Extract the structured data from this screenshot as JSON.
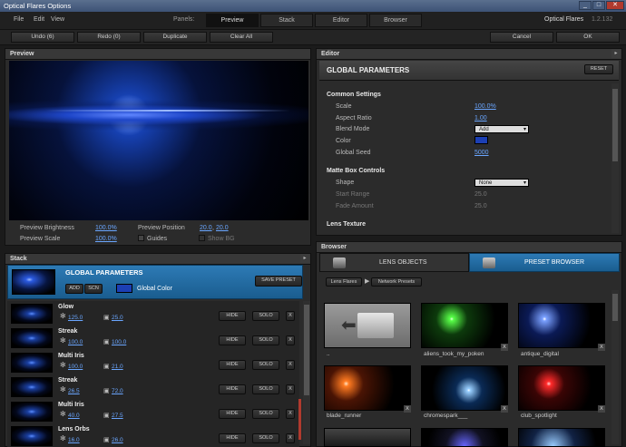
{
  "window": {
    "title": "Optical Flares Options"
  },
  "menu": [
    "File",
    "Edit",
    "View"
  ],
  "panels": {
    "label": "Panels:",
    "tabs": [
      "Preview",
      "Stack",
      "Editor",
      "Browser"
    ]
  },
  "app": {
    "name": "Optical Flares",
    "version": "1.2.132"
  },
  "toolbar": {
    "undo": "Undo (6)",
    "redo": "Redo (0)",
    "duplicate": "Duplicate",
    "clear_all": "Clear All",
    "cancel": "Cancel",
    "ok": "OK"
  },
  "preview": {
    "title": "Preview",
    "brightness_label": "Preview Brightness",
    "brightness_value": "100.0%",
    "position_label": "Preview Position",
    "position_x": "20.0",
    "position_y": "20.0",
    "scale_label": "Preview Scale",
    "scale_value": "100.0%",
    "guides_label": "Guides",
    "showbg_label": "Show BG"
  },
  "editor": {
    "title": "Editor",
    "header": "GLOBAL PARAMETERS",
    "reset": "RESET",
    "common_title": "Common Settings",
    "scale_label": "Scale",
    "scale_value": "100.0%",
    "aspect_label": "Aspect Ratio",
    "aspect_value": "1.00",
    "blend_label": "Blend Mode",
    "blend_value": "Add",
    "color_label": "Color",
    "color_value": "#1c3fb4",
    "seed_label": "Global Seed",
    "seed_value": "5000",
    "matte_title": "Matte Box Controls",
    "shape_label": "Shape",
    "shape_value": "None",
    "start_label": "Start Range",
    "start_value": "25.0",
    "fade_label": "Fade Amount",
    "fade_value": "25.0",
    "texture_title": "Lens Texture"
  },
  "stack": {
    "title": "Stack",
    "global_title": "GLOBAL PARAMETERS",
    "add": "ADD",
    "scn": "SCN",
    "global_color": "Global Color",
    "save_preset": "SAVE PRESET",
    "hide": "HIDE",
    "solo": "SOLO",
    "x": "X",
    "items": [
      {
        "name": "Glow",
        "v1": "125.0",
        "v2": "25.0"
      },
      {
        "name": "Streak",
        "v1": "100.0",
        "v2": "100.0"
      },
      {
        "name": "Multi Iris",
        "v1": "100.0",
        "v2": "21.0"
      },
      {
        "name": "Streak",
        "v1": "26.5",
        "v2": "72.0"
      },
      {
        "name": "Multi Iris",
        "v1": "40.0",
        "v2": "27.5"
      },
      {
        "name": "Lens Orbs",
        "v1": "16.0",
        "v2": "26.0"
      }
    ]
  },
  "browser": {
    "title": "Browser",
    "tab_lens": "LENS OBJECTS",
    "tab_preset": "PRESET BROWSER",
    "crumb1": "Lens Flares",
    "crumb2": "Network Presets",
    "items": [
      "..",
      "aliens_took_my_poken",
      "antique_digital",
      "blade_runner",
      "chromespark___",
      "club_spotlight"
    ],
    "x": "X"
  },
  "colors": {
    "accent": "#1f6fa8",
    "link": "#6aa6ff"
  }
}
